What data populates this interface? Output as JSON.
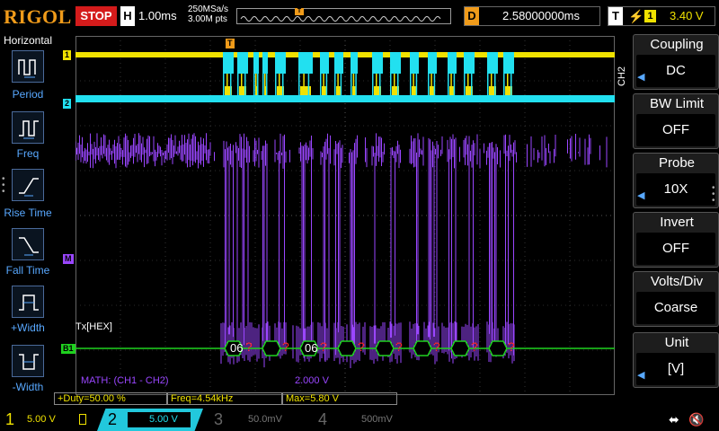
{
  "brand": "RIGOL",
  "run_state": "STOP",
  "horizontal": {
    "letter": "H",
    "timebase": "1.00ms",
    "sample_rate": "250MSa/s",
    "points": "3.00M pts"
  },
  "delay": {
    "letter": "D",
    "value": "2.58000000ms"
  },
  "trigger": {
    "letter": "T",
    "edge_icon": "rising-edge-icon",
    "source": "1",
    "level": "3.40 V"
  },
  "left_menu": {
    "title": "Horizontal",
    "items": [
      {
        "label": "Period",
        "icon": "period-icon"
      },
      {
        "label": "Freq",
        "icon": "freq-icon"
      },
      {
        "label": "Rise Time",
        "icon": "rise-time-icon"
      },
      {
        "label": "Fall Time",
        "icon": "fall-time-icon"
      },
      {
        "label": "+Width",
        "icon": "pos-width-icon"
      },
      {
        "label": "-Width",
        "icon": "neg-width-icon"
      }
    ]
  },
  "screen": {
    "markers": {
      "ch1": "1",
      "ch2": "2",
      "math": "M",
      "bus": "B1",
      "trigger_pos": "T"
    },
    "bus_label": "Tx[HEX]",
    "decode_values": [
      "06",
      "?",
      "06",
      "?",
      "?",
      "?",
      "?",
      "?",
      "?",
      "?"
    ],
    "math_label": "MATH: (CH1 - CH2)",
    "math_scale": "2.000 V"
  },
  "measurements": [
    {
      "label": "+Duty=50.00 %"
    },
    {
      "label": "Freq=4.54kHz"
    },
    {
      "label": "Max=5.80 V"
    }
  ],
  "channels": [
    {
      "num": "1",
      "scale": "5.00 V",
      "color": "#f0e200",
      "active": true
    },
    {
      "num": "2",
      "scale": "5.00 V",
      "color": "#22e0f0",
      "active": true
    },
    {
      "num": "3",
      "scale": "50.0mV",
      "color": "#888888",
      "active": false
    },
    {
      "num": "4",
      "scale": "500mV",
      "color": "#888888",
      "active": false
    }
  ],
  "right_menu": {
    "channel": "CH2",
    "items": [
      {
        "title": "Coupling",
        "value": "DC"
      },
      {
        "title": "BW Limit",
        "value": "OFF"
      },
      {
        "title": "Probe",
        "value": "10X"
      },
      {
        "title": "Invert",
        "value": "OFF"
      },
      {
        "title": "Volts/Div",
        "value": "Coarse"
      },
      {
        "title": "Unit",
        "value": "[V]"
      }
    ]
  },
  "colors": {
    "ch1": "#f0e200",
    "ch2": "#22e0f0",
    "math": "#9a46ff",
    "bus": "#1fd21f",
    "brand": "#f09b1a",
    "menu_accent": "#58a8ff"
  }
}
